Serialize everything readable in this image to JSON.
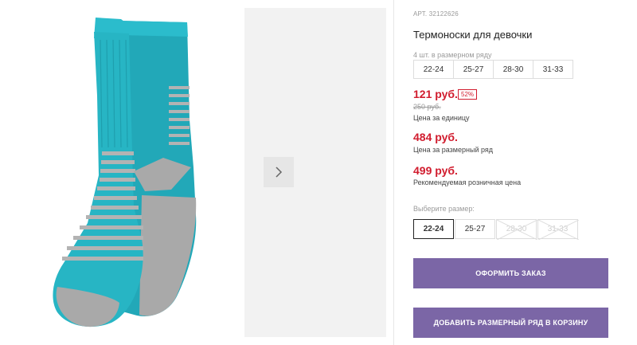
{
  "product": {
    "sku": "АРТ. 32122626",
    "title": "Термоноски для девочки",
    "pack_note": "4 шт. в размерном ряду",
    "pack_sizes": [
      "22-24",
      "25-27",
      "28-30",
      "31-33"
    ]
  },
  "pricing": {
    "unit_price": "121 руб.",
    "discount": "52%",
    "old_price": "250 руб.",
    "unit_label": "Цена за единицу",
    "range_price": "484 руб.",
    "range_label": "Цена за размерный ряд",
    "retail_price": "499 руб.",
    "retail_label": "Рекомендуемая розничная цена"
  },
  "size_select": {
    "prompt": "Выберите размер:",
    "options": [
      {
        "label": "22-24",
        "state": "selected"
      },
      {
        "label": "25-27",
        "state": "available"
      },
      {
        "label": "28-30",
        "state": "unavailable"
      },
      {
        "label": "31-33",
        "state": "unavailable"
      }
    ]
  },
  "actions": {
    "order_label": "ОФОРМИТЬ ЗАКАЗ",
    "cart_label": "ДОБАВИТЬ РАЗМЕРНЫЙ РЯД В КОРЗИНУ"
  },
  "colors": {
    "accent": "#7b66a6",
    "price_red": "#d11c2e",
    "sock_teal": "#27b5c4",
    "sock_gray": "#a9a9a9"
  },
  "icons": {
    "next": "chevron-right-icon"
  }
}
